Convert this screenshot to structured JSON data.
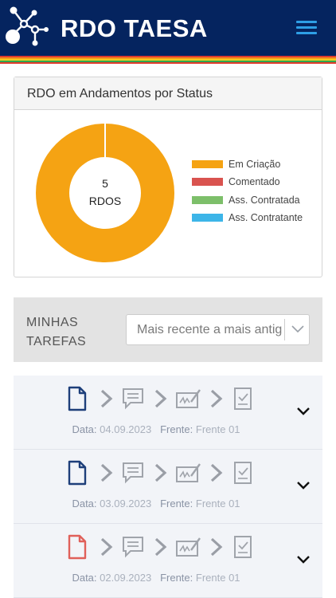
{
  "header": {
    "title": "RDO TAESA",
    "logo_icon": "molecule-network-icon",
    "menu_icon": "hamburger-menu-icon"
  },
  "colors": {
    "header_bg": "#05245f",
    "accent": "#2e9fe6",
    "status_created": "#f5a313"
  },
  "stripe_colors": [
    "#e03a2c",
    "#f59a1b",
    "#f1cf1d",
    "#2fa84f",
    "#e03a2c"
  ],
  "status_card": {
    "title": "RDO em Andamentos por Status",
    "total_value": "5",
    "total_label": "RDOS",
    "legend": [
      {
        "label": "Em Criação",
        "color": "#f5a313"
      },
      {
        "label": "Comentado",
        "color": "#d9534f"
      },
      {
        "label": "Ass. Contratada",
        "color": "#7dbf6a"
      },
      {
        "label": "Ass. Contratante",
        "color": "#3db5e8"
      }
    ]
  },
  "chart_data": {
    "type": "pie",
    "categories": [
      "Em Criação",
      "Comentado",
      "Ass. Contratada",
      "Ass. Contratante"
    ],
    "values": [
      5,
      0,
      0,
      0
    ],
    "center_text": [
      "5",
      "RDOS"
    ],
    "legend_position": "right"
  },
  "tasks_section": {
    "label_line1": "MINHAS",
    "label_line2": "TAREFAS",
    "sort_value": "Mais recente a mais antigo",
    "sort_icon": "chevron-down-icon"
  },
  "tasks": [
    {
      "date_label": "Data:",
      "date": "04.09.2023",
      "front_label": "Frente:",
      "front": "Frente 01",
      "doc_color": "#1e3f7a"
    },
    {
      "date_label": "Data:",
      "date": "03.09.2023",
      "front_label": "Frente:",
      "front": "Frente 01",
      "doc_color": "#1e3f7a"
    },
    {
      "date_label": "Data:",
      "date": "02.09.2023",
      "front_label": "Frente:",
      "front": "Frente 01",
      "doc_color": "#e0605a"
    }
  ]
}
